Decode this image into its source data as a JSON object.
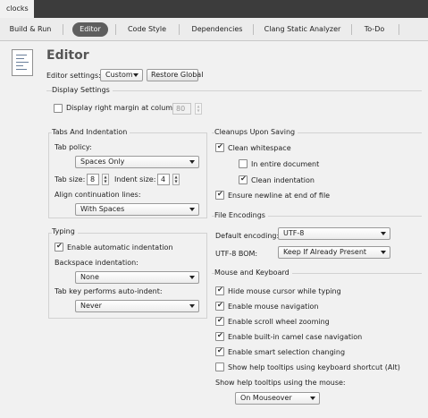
{
  "document_tab": "clocks",
  "settings_tabs": [
    {
      "label": "Build & Run"
    },
    {
      "label": "Editor"
    },
    {
      "label": "Code Style"
    },
    {
      "label": "Dependencies"
    },
    {
      "label": "Clang Static Analyzer"
    },
    {
      "label": "To-Do"
    }
  ],
  "active_tab": "Editor",
  "header": {
    "title": "Editor",
    "settings_label": "Editor settings:",
    "settings_value": "Custom",
    "restore_button": "Restore Global"
  },
  "display_settings": {
    "title": "Display Settings",
    "right_margin_label": "Display right margin at column:",
    "right_margin_checked": false,
    "right_margin_value": "80"
  },
  "tabs_indentation": {
    "title": "Tabs And Indentation",
    "tab_policy_label": "Tab policy:",
    "tab_policy_value": "Spaces Only",
    "tab_size_label": "Tab size:",
    "tab_size_value": "8",
    "indent_size_label": "Indent size:",
    "indent_size_value": "4",
    "align_label": "Align continuation lines:",
    "align_value": "With Spaces"
  },
  "typing": {
    "title": "Typing",
    "auto_indent_label": "Enable automatic indentation",
    "auto_indent_checked": true,
    "backspace_label": "Backspace indentation:",
    "backspace_value": "None",
    "tab_key_label": "Tab key performs auto-indent:",
    "tab_key_value": "Never"
  },
  "cleanups": {
    "title": "Cleanups Upon Saving",
    "clean_whitespace_label": "Clean whitespace",
    "clean_whitespace_checked": true,
    "entire_document_label": "In entire document",
    "entire_document_checked": false,
    "clean_indentation_label": "Clean indentation",
    "clean_indentation_checked": true,
    "ensure_newline_label": "Ensure newline at end of file",
    "ensure_newline_checked": true
  },
  "file_encodings": {
    "title": "File Encodings",
    "default_encoding_label": "Default encoding:",
    "default_encoding_value": "UTF-8",
    "bom_label": "UTF-8 BOM:",
    "bom_value": "Keep If Already Present"
  },
  "mouse_keyboard": {
    "title": "Mouse and Keyboard",
    "options": [
      {
        "label": "Hide mouse cursor while typing",
        "checked": true
      },
      {
        "label": "Enable mouse navigation",
        "checked": true
      },
      {
        "label": "Enable scroll wheel zooming",
        "checked": true
      },
      {
        "label": "Enable built-in camel case navigation",
        "checked": true
      },
      {
        "label": "Enable smart selection changing",
        "checked": true
      },
      {
        "label": "Show help tooltips using keyboard shortcut (Alt)",
        "checked": false
      }
    ],
    "tooltips_label": "Show help tooltips using the mouse:",
    "tooltips_value": "On Mouseover"
  },
  "colors": {
    "window_bg": "#f1f1f1",
    "top_bar": "#3c3c3c",
    "active_tab_bg": "#5e5e5e",
    "group_border": "#d2d2d2"
  }
}
